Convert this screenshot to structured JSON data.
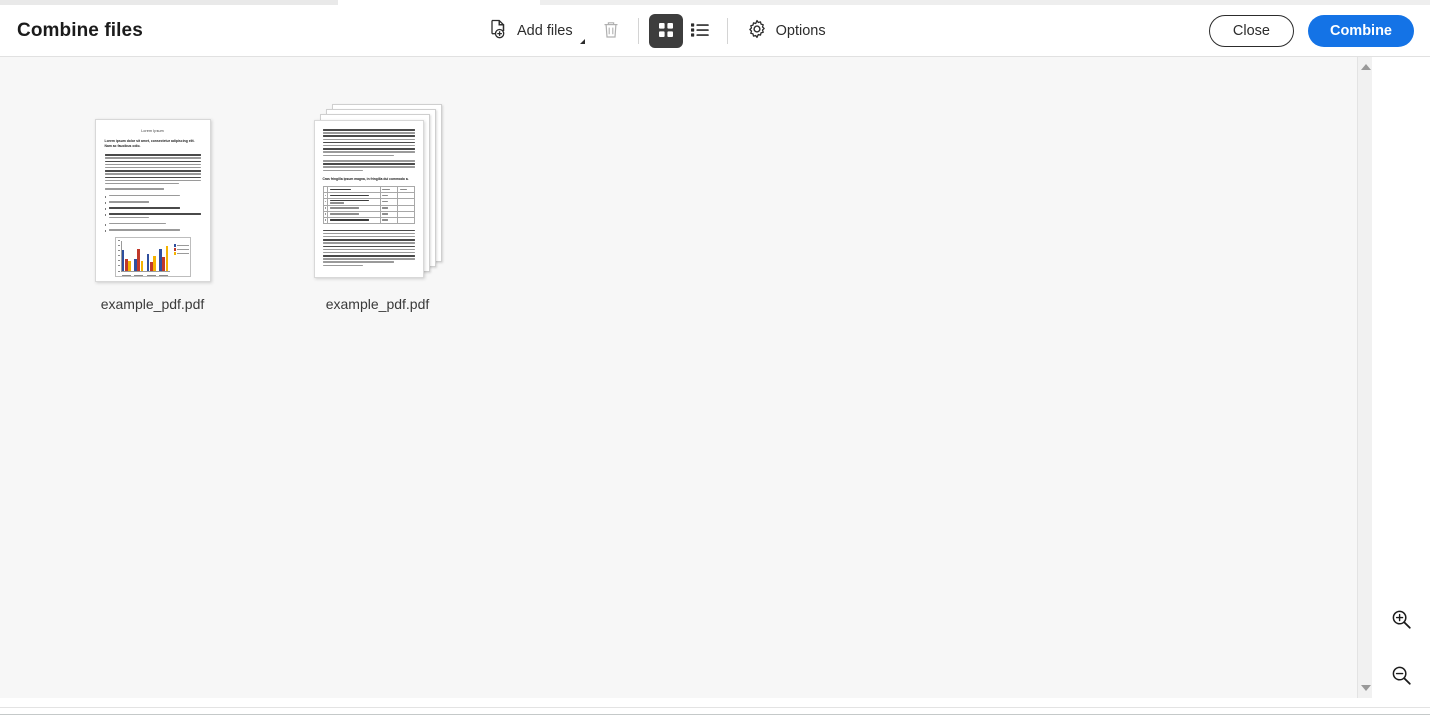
{
  "window": {
    "title": "Combine files"
  },
  "toolbar": {
    "add_files_label": "Add files",
    "add_files_icon": "page-add-icon",
    "dropdown_icon": "dropdown-caret-icon",
    "delete_icon": "trash-icon",
    "grid_view_icon": "grid-view-icon",
    "list_view_icon": "list-view-icon",
    "options_label": "Options",
    "options_icon": "gear-icon",
    "active_view": "grid",
    "delete_enabled": false
  },
  "actions": {
    "close_label": "Close",
    "combine_label": "Combine",
    "combine_color": "#1473e6"
  },
  "files": [
    {
      "name": "example_pdf.pdf",
      "pages": 1,
      "type": "single",
      "preview": {
        "title": "Lorem Ipsum",
        "heading": "Lorem ipsum dolor sit amet, consectetur adipiscing elit. Nam ac faucibus odio.",
        "has_chart": true
      }
    },
    {
      "name": "example_pdf.pdf",
      "pages": 4,
      "type": "stack",
      "preview": {
        "heading": "Cras fringilla ipsum magna, in fringilla dui commodo a.",
        "has_table": true
      }
    }
  ],
  "chart_data": {
    "type": "bar",
    "title": "",
    "categories": [
      "Cat 1",
      "Cat 2",
      "Cat 3",
      "Cat 4"
    ],
    "series": [
      {
        "name": "Series 1",
        "color": "#2f4f9e",
        "values": [
          4.3,
          2.5,
          3.5,
          4.5
        ]
      },
      {
        "name": "Series 2",
        "color": "#c0392b",
        "values": [
          2.4,
          4.4,
          1.8,
          2.8
        ]
      },
      {
        "name": "Series 3",
        "color": "#f5b301",
        "values": [
          2.0,
          2.0,
          3.0,
          5.0
        ]
      }
    ],
    "ylim": [
      0,
      6
    ],
    "xlabel": "",
    "ylabel": "",
    "grid": false,
    "legend_position": "right"
  },
  "scrollbar": {
    "up_icon": "scroll-up-arrow-icon",
    "down_icon": "scroll-down-arrow-icon"
  },
  "zoom_controls": {
    "zoom_in_icon": "zoom-in-icon",
    "zoom_out_icon": "zoom-out-icon"
  }
}
